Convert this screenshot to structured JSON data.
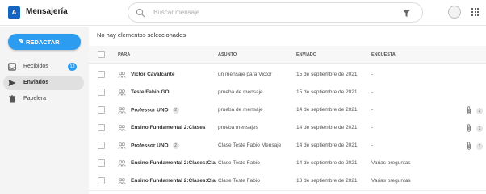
{
  "app": {
    "logo_text": "A",
    "title": "Mensajería"
  },
  "search": {
    "placeholder": "Buscar mensaje"
  },
  "sidebar": {
    "compose_label": "REDACTAR",
    "items": [
      {
        "label": "Recibidos",
        "icon": "inbox-icon",
        "badge": "13"
      },
      {
        "label": "Enviados",
        "icon": "send-icon",
        "active": true
      },
      {
        "label": "Papelera",
        "icon": "trash-icon"
      }
    ]
  },
  "main": {
    "selection_text": "No hay elementos seleccionados",
    "columns": {
      "to": "PARA",
      "subject": "ASUNTO",
      "sent": "ENVIADO",
      "survey": "ENCUESTA"
    },
    "rows": [
      {
        "to": "Victor Cavalcante",
        "count": "",
        "subject": "un mensaje para Victor",
        "sent": "15 de septiembre de 2021",
        "survey": "-",
        "attachments": ""
      },
      {
        "to": "Teste Fabio GO",
        "count": "",
        "subject": "prueba de mensaje",
        "sent": "15 de septiembre de 2021",
        "survey": "-",
        "attachments": ""
      },
      {
        "to": "Professor UNO",
        "count": "2",
        "subject": "prueba de mensaje",
        "sent": "14 de septiembre de 2021",
        "survey": "-",
        "attachments": "2"
      },
      {
        "to": "Ensino Fundamental 2:Clases",
        "count": "",
        "subject": "prueba mensajes",
        "sent": "14 de septiembre de 2021",
        "survey": "-",
        "attachments": "1"
      },
      {
        "to": "Professor UNO",
        "count": "2",
        "subject": "Clase Teste Fabio Mensaje",
        "sent": "14 de septiembre de 2021",
        "survey": "-",
        "attachments": "1"
      },
      {
        "to": "Ensino Fundamental 2:Clases:Cla",
        "count": "",
        "subject": "Clase Teste Fabio",
        "sent": "14 de septiembre de 2021",
        "survey": "Varias preguntas",
        "attachments": ""
      },
      {
        "to": "Ensino Fundamental 2:Clases:Cla",
        "count": "",
        "subject": "Clase Teste Fabio",
        "sent": "13 de septiembre de 2021",
        "survey": "Varias preguntas",
        "attachments": ""
      }
    ]
  }
}
